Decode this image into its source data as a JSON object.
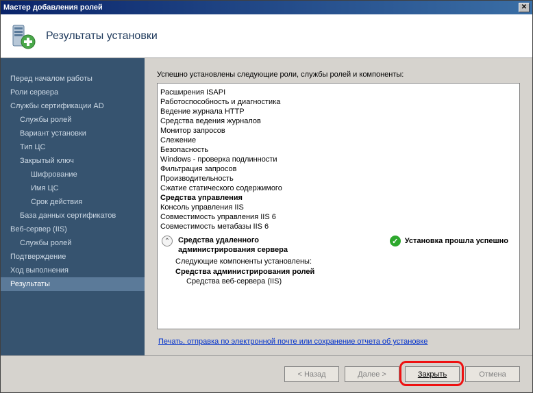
{
  "window": {
    "title": "Мастер добавления ролей"
  },
  "header": {
    "title": "Результаты установки"
  },
  "sidebar": {
    "items": [
      {
        "label": "Перед началом работы",
        "level": 0
      },
      {
        "label": "Роли сервера",
        "level": 0
      },
      {
        "label": "Службы сертификации AD",
        "level": 0
      },
      {
        "label": "Службы ролей",
        "level": 1
      },
      {
        "label": "Вариант установки",
        "level": 1
      },
      {
        "label": "Тип ЦС",
        "level": 1
      },
      {
        "label": "Закрытый ключ",
        "level": 1
      },
      {
        "label": "Шифрование",
        "level": 2
      },
      {
        "label": "Имя ЦС",
        "level": 2
      },
      {
        "label": "Срок действия",
        "level": 2
      },
      {
        "label": "База данных сертификатов",
        "level": 1
      },
      {
        "label": "Веб-сервер (IIS)",
        "level": 0
      },
      {
        "label": "Службы ролей",
        "level": 1
      },
      {
        "label": "Подтверждение",
        "level": 0
      },
      {
        "label": "Ход выполнения",
        "level": 0
      },
      {
        "label": "Результаты",
        "level": 0,
        "selected": true
      }
    ]
  },
  "main": {
    "intro": "Успешно установлены следующие роли, службы ролей и компоненты:",
    "tree": [
      {
        "text": "Расширения ISAPI",
        "cls": "ind1"
      },
      {
        "text": "Работоспособность и диагностика",
        "cls": "ind2"
      },
      {
        "text": "Ведение журнала HTTP",
        "cls": "ind1"
      },
      {
        "text": "Средства ведения журналов",
        "cls": "ind1"
      },
      {
        "text": "Монитор запросов",
        "cls": "ind1"
      },
      {
        "text": "Слежение",
        "cls": "ind1"
      },
      {
        "text": "Безопасность",
        "cls": "ind2"
      },
      {
        "text": "Windows - проверка подлинности",
        "cls": "ind1"
      },
      {
        "text": "Фильтрация запросов",
        "cls": "ind1"
      },
      {
        "text": "Производительность",
        "cls": "ind2"
      },
      {
        "text": "Сжатие статического содержимого",
        "cls": "ind1"
      },
      {
        "text": "Средства управления",
        "cls": "ind0b"
      },
      {
        "text": "Консоль управления IIS",
        "cls": "ind1n"
      },
      {
        "text": "Совместимость управления IIS 6",
        "cls": "ind1n"
      },
      {
        "text": "Совместимость метабазы IIS 6",
        "cls": "ind2n"
      }
    ],
    "section2": {
      "title_l1": "Средства удаленного",
      "title_l2": "администрирования сервера",
      "status": "Установка прошла успешно",
      "note": "Следующие компоненты установлены:",
      "bold": "Средства администрирования ролей",
      "sub": "Средства веб-сервера (IIS)"
    },
    "link": "Печать, отправка по электронной почте или сохранение отчета об установке"
  },
  "footer": {
    "back": "< Назад",
    "next": "Далее >",
    "close": "Закрыть",
    "cancel": "Отмена"
  }
}
